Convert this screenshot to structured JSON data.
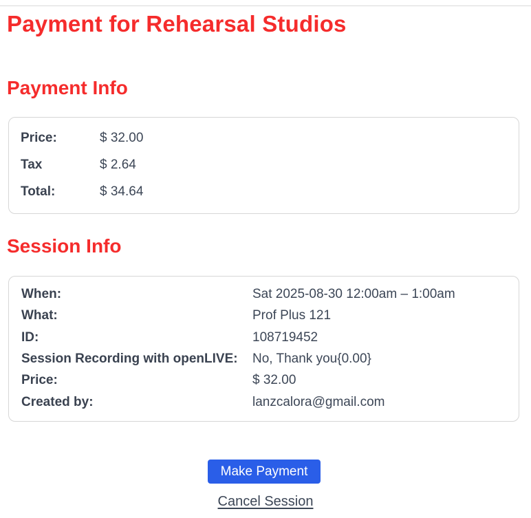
{
  "page": {
    "title": "Payment for Rehearsal Studios"
  },
  "payment_info": {
    "heading": "Payment Info",
    "rows": [
      {
        "label": "Price:",
        "value": "$ 32.00"
      },
      {
        "label": "Tax",
        "value": "$ 2.64"
      },
      {
        "label": "Total:",
        "value": "$ 34.64"
      }
    ]
  },
  "session_info": {
    "heading": "Session Info",
    "rows": [
      {
        "label": "When:",
        "value": "Sat 2025-08-30 12:00am – 1:00am"
      },
      {
        "label": "What:",
        "value": "Prof Plus 121"
      },
      {
        "label": "ID:",
        "value": "108719452"
      },
      {
        "label": "Session Recording with openLIVE:",
        "value": "No, Thank you{0.00}"
      },
      {
        "label": "Price:",
        "value": "$ 32.00"
      },
      {
        "label": "Created by:",
        "value": "lanzcalora@gmail.com"
      }
    ]
  },
  "actions": {
    "make_payment_label": "Make Payment",
    "cancel_session_label": "Cancel Session"
  },
  "colors": {
    "heading_red": "#f52c2c",
    "button_blue": "#2a5ee8",
    "text_dark": "#3c4656"
  }
}
